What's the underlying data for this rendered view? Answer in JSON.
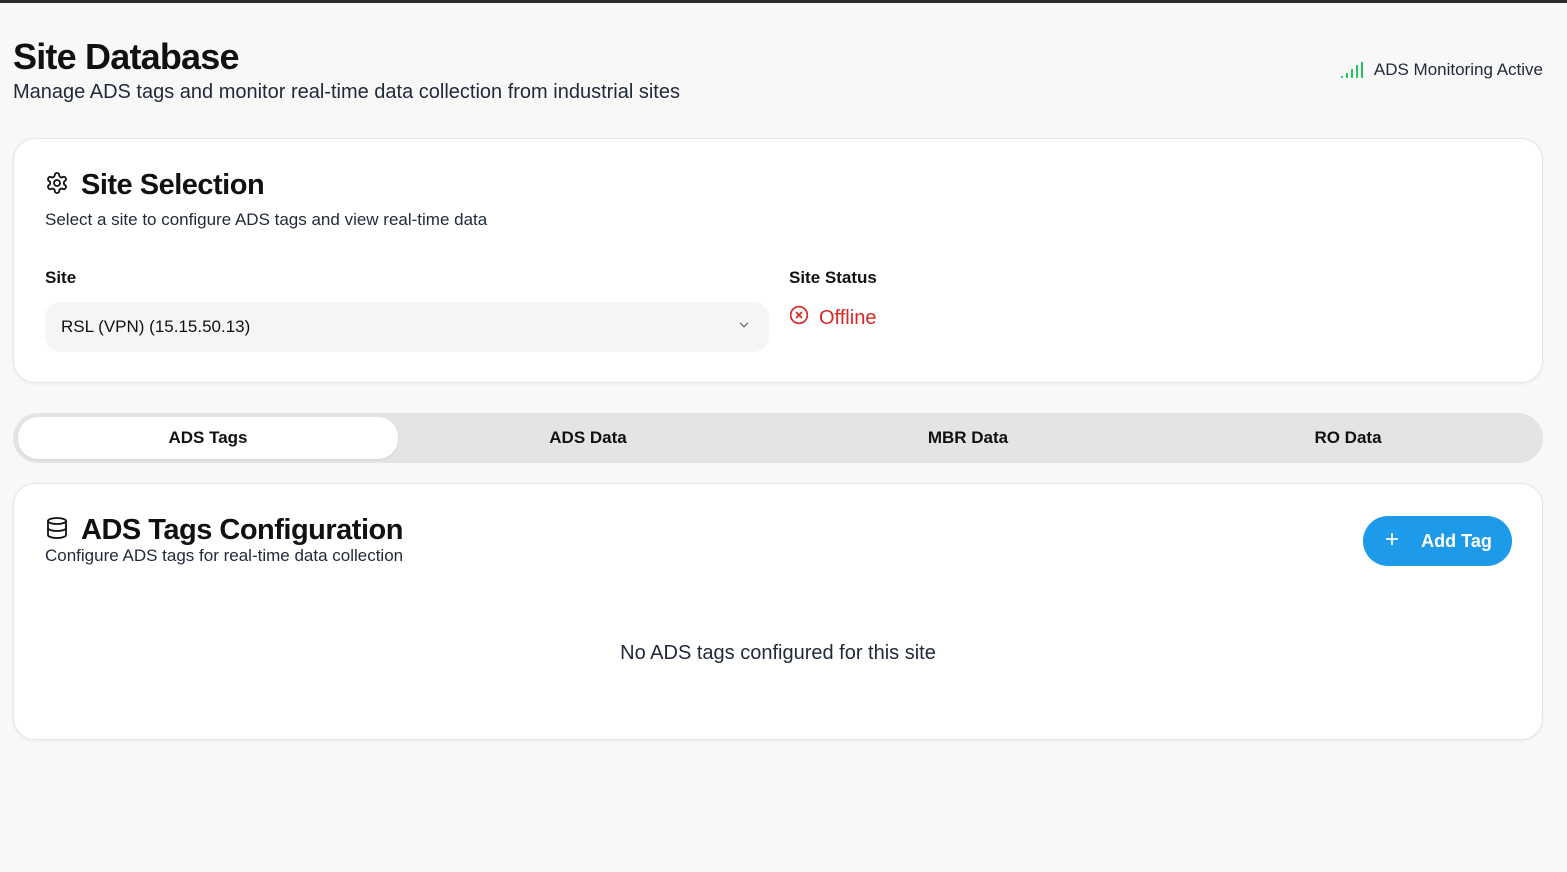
{
  "header": {
    "title": "Site Database",
    "subtitle": "Manage ADS tags and monitor real-time data collection from industrial sites",
    "monitor_status": "ADS Monitoring Active",
    "monitor_icon": "signal-bars-icon"
  },
  "site_selection": {
    "title": "Site Selection",
    "icon": "gear-icon",
    "description": "Select a site to configure ADS tags and view real-time data",
    "site_label": "Site",
    "site_value": "RSL (VPN) (15.15.50.13)",
    "status_label": "Site Status",
    "status_value": "Offline",
    "status_icon": "x-circle-icon"
  },
  "tabs": [
    {
      "label": "ADS Tags",
      "active": true
    },
    {
      "label": "ADS Data",
      "active": false
    },
    {
      "label": "MBR Data",
      "active": false
    },
    {
      "label": "RO Data",
      "active": false
    }
  ],
  "tags_config": {
    "title": "ADS Tags Configuration",
    "icon": "database-icon",
    "description": "Configure ADS tags for real-time data collection",
    "add_button": "Add Tag",
    "empty_message": "No ADS tags configured for this site"
  },
  "colors": {
    "accent": "#1e9be8",
    "offline": "#dc2626",
    "monitor": "#22c55e"
  }
}
